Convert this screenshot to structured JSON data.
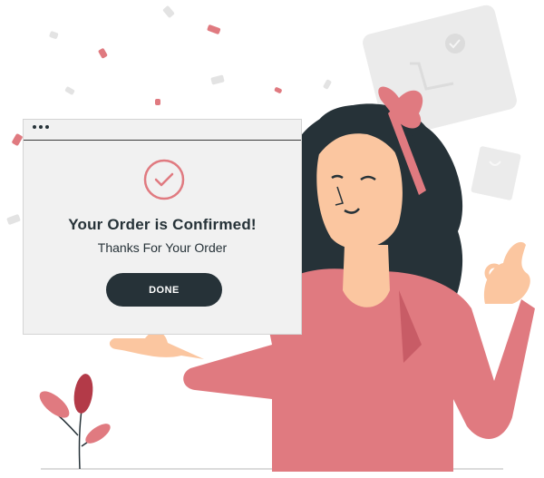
{
  "dialog": {
    "title": "Your Order is Confirmed!",
    "subtitle": "Thanks For Your Order",
    "done_label": "DONE"
  },
  "colors": {
    "accent": "#e07a80",
    "dark": "#263238",
    "dialog_bg": "#f1f1f1",
    "shirt": "#e07a80",
    "skin": "#fbc6a0"
  }
}
